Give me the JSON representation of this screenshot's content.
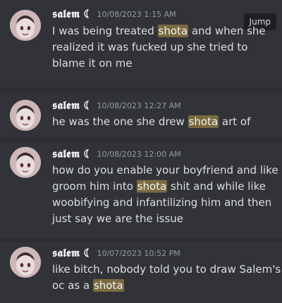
{
  "results": [
    {
      "username": "𝖘𝖆𝖑𝖊𝖒 ☾",
      "timestamp": "10/08/2023 1:15 AM",
      "jump_label": "Jump",
      "lines": [
        [
          {
            "t": "I was being treated "
          },
          {
            "t": "shota",
            "hl": true
          },
          {
            "t": " and when she"
          }
        ],
        [
          {
            "t": "realized it was fucked up she tried to"
          }
        ],
        [
          {
            "t": "blame it on me"
          }
        ]
      ]
    },
    {
      "username": "𝖘𝖆𝖑𝖊𝖒 ☾",
      "timestamp": "10/08/2023 12:27 AM",
      "lines": [
        [
          {
            "t": "he was the one she drew "
          },
          {
            "t": "shota",
            "hl": true
          },
          {
            "t": " art of"
          }
        ]
      ]
    },
    {
      "username": "𝖘𝖆𝖑𝖊𝖒 ☾",
      "timestamp": "10/08/2023 12:00 AM",
      "lines": [
        [
          {
            "t": "how do you enable your boyfriend and like"
          }
        ],
        [
          {
            "t": "groom him into "
          },
          {
            "t": "shota",
            "hl": true
          },
          {
            "t": " shit and while like"
          }
        ],
        [
          {
            "t": "woobifying and infantilizing him and then"
          }
        ],
        [
          {
            "t": "just say we are the issue"
          }
        ]
      ]
    },
    {
      "username": "𝖘𝖆𝖑𝖊𝖒 ☾",
      "timestamp": "10/07/2023 10:52 PM",
      "lines": [
        [
          {
            "t": "like bitch, nobody told you to draw Salem's"
          }
        ],
        [
          {
            "t": "oc as a "
          },
          {
            "t": "shota",
            "hl": true
          }
        ]
      ]
    }
  ]
}
